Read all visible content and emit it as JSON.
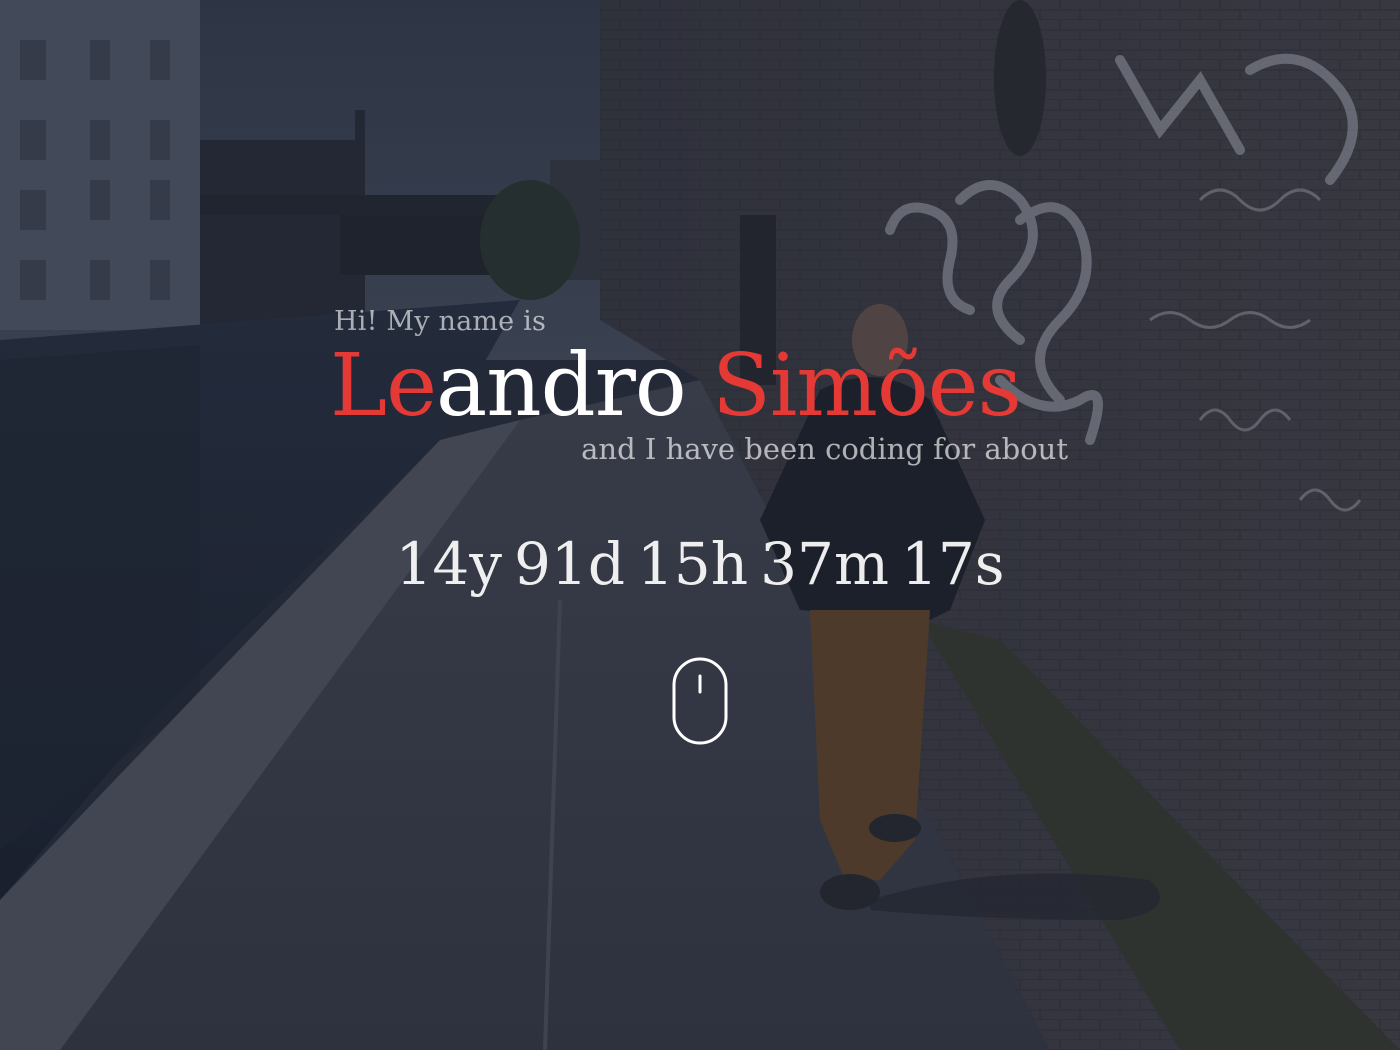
{
  "hero": {
    "background_icon": "canal-street-photo",
    "greeting": "Hi! My name is",
    "name": {
      "parts": [
        "Le",
        "andro",
        " ",
        "Simões"
      ]
    },
    "subtitle": "and I have been coding for about",
    "counter": {
      "years": "14y",
      "days": "91d",
      "hours": "15h",
      "minutes": "37m",
      "seconds": "17s"
    },
    "scroll_icon": "mouse-scroll-icon"
  },
  "colors": {
    "accent": "#e53935",
    "text": "#ffffff",
    "overlay": "#181e2c"
  }
}
